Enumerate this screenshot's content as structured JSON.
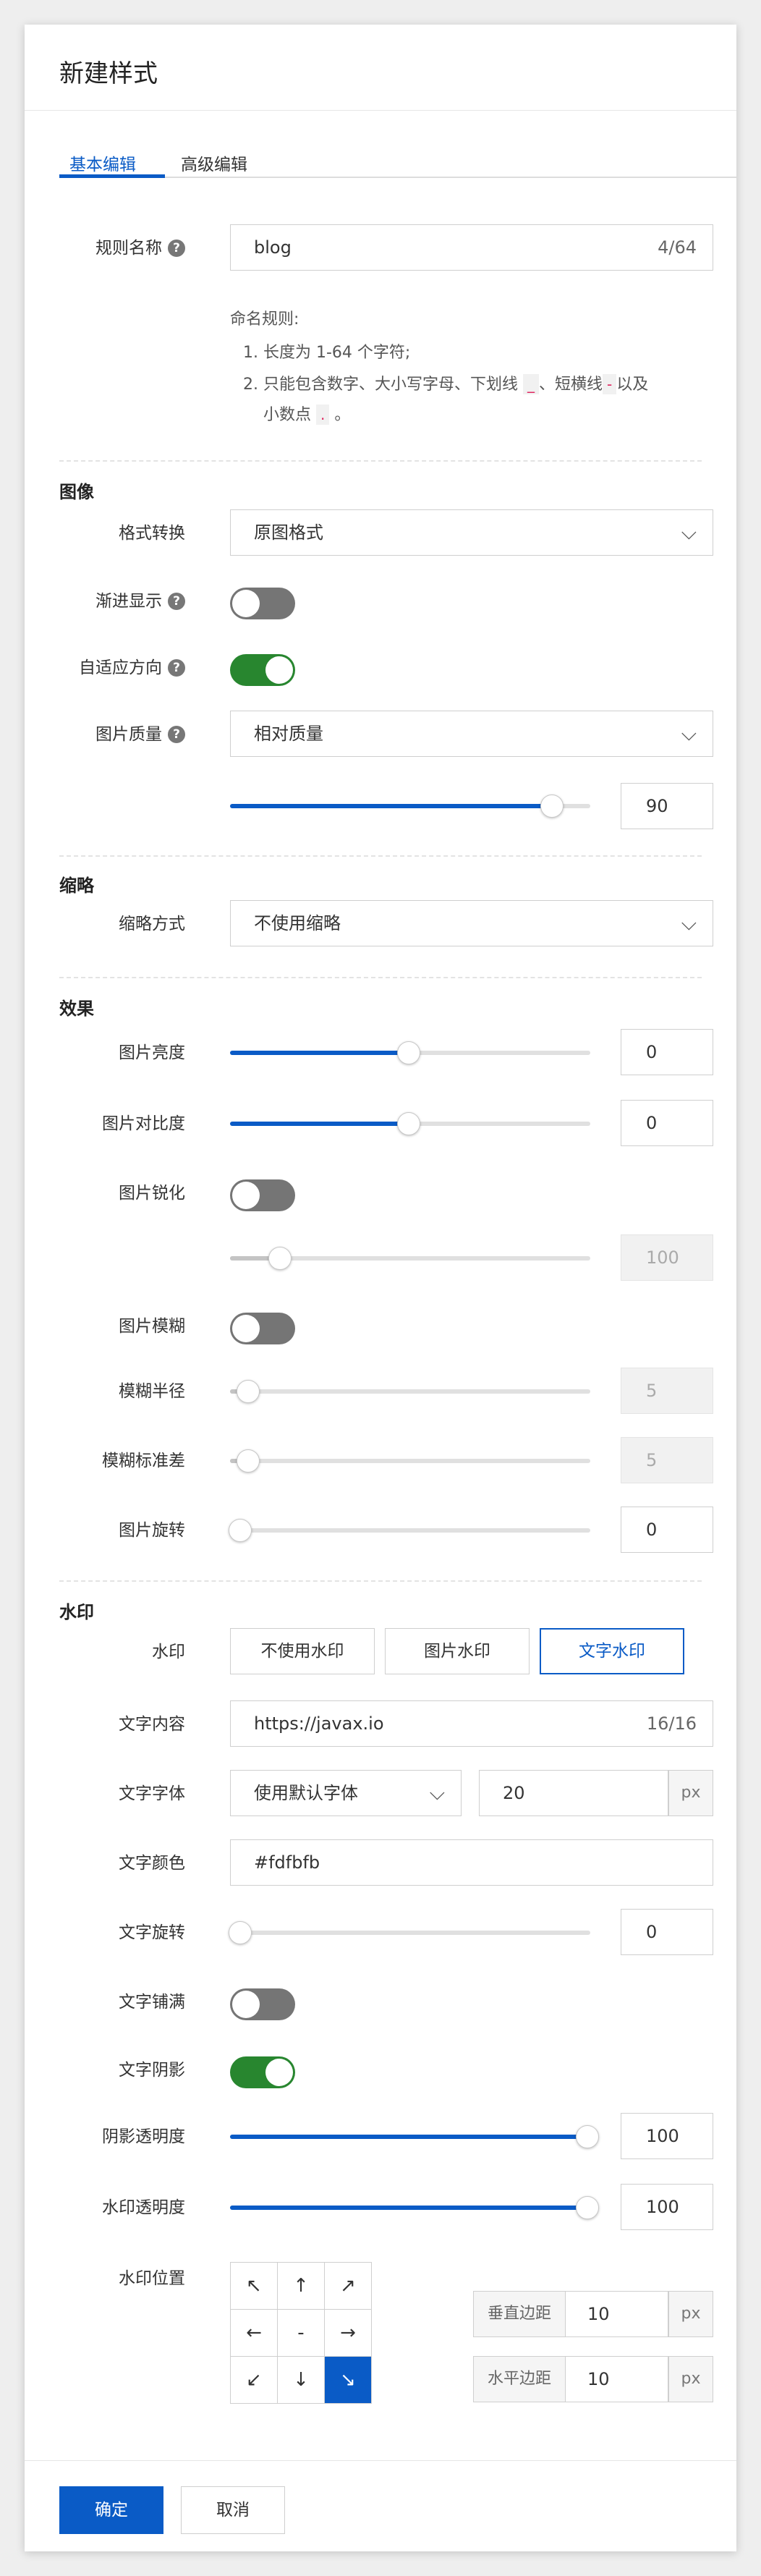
{
  "dialog": {
    "title": "新建样式"
  },
  "tabs": [
    {
      "label": "基本编辑",
      "active": true
    },
    {
      "label": "高级编辑",
      "active": false
    }
  ],
  "rule_name": {
    "label": "规则名称",
    "value": "blog",
    "counter": "4/64",
    "hint_title": "命名规则:",
    "hint_1": "1. 长度为 1-64 个字符;",
    "hint_2a": "2. 只能包含数字、大小写字母、下划线",
    "underscore": "_",
    "hint_2b": "、短横线",
    "dash": "-",
    "hint_2c": "以及",
    "hint_2d": "小数点",
    "dot": ".",
    "hint_2e": "。"
  },
  "image": {
    "section": "图像",
    "format_label": "格式转换",
    "format_value": "原图格式",
    "progressive_label": "渐进显示",
    "progressive_on": false,
    "auto_orient_label": "自适应方向",
    "auto_orient_on": true,
    "quality_label": "图片质量",
    "quality_mode": "相对质量",
    "quality_value": "90",
    "quality_level": 0.9
  },
  "thumbnail": {
    "section": "缩略",
    "mode_label": "缩略方式",
    "mode_value": "不使用缩略"
  },
  "effects": {
    "section": "效果",
    "brightness_label": "图片亮度",
    "brightness_value": "0",
    "brightness_level": 0.5,
    "contrast_label": "图片对比度",
    "contrast_value": "0",
    "contrast_level": 0.5,
    "sharpen_label": "图片锐化",
    "sharpen_on": false,
    "sharpen_value": "100",
    "sharpen_level": 0.14,
    "blur_label": "图片模糊",
    "blur_on": false,
    "blur_radius_label": "模糊半径",
    "blur_radius_value": "5",
    "blur_radius_level": 0.05,
    "blur_sigma_label": "模糊标准差",
    "blur_sigma_value": "5",
    "blur_sigma_level": 0.05,
    "rotate_label": "图片旋转",
    "rotate_value": "0",
    "rotate_level": 0
  },
  "watermark": {
    "section": "水印",
    "type_label": "水印",
    "type_options": [
      "不使用水印",
      "图片水印",
      "文字水印"
    ],
    "type_selected": "文字水印",
    "text_label": "文字内容",
    "text_value": "https://javax.io",
    "text_counter": "16/16",
    "font_label": "文字字体",
    "font_value": "使用默认字体",
    "font_size": "20",
    "font_unit": "px",
    "color_label": "文字颜色",
    "color_value": "#fdfbfb",
    "text_rotate_label": "文字旋转",
    "text_rotate_value": "0",
    "text_rotate_level": 0,
    "tile_label": "文字铺满",
    "tile_on": false,
    "shadow_label": "文字阴影",
    "shadow_on": true,
    "shadow_opacity_label": "阴影透明度",
    "shadow_opacity_value": "100",
    "shadow_opacity_level": 1,
    "opacity_label": "水印透明度",
    "opacity_value": "100",
    "opacity_level": 1,
    "position_label": "水印位置",
    "positions": [
      "↖",
      "↑",
      "↗",
      "←",
      "-",
      "→",
      "↙",
      "↓",
      "↘"
    ],
    "position_selected": "↘",
    "v_margin_label": "垂直边距",
    "v_margin_value": "10",
    "v_margin_unit": "px",
    "h_margin_label": "水平边距",
    "h_margin_value": "10",
    "h_margin_unit": "px"
  },
  "footer": {
    "ok_label": "确定",
    "cancel_label": "取消"
  },
  "colors": {
    "accent": "#0a5bc6",
    "toggle_on": "#28862f",
    "toggle_off": "#757575"
  }
}
